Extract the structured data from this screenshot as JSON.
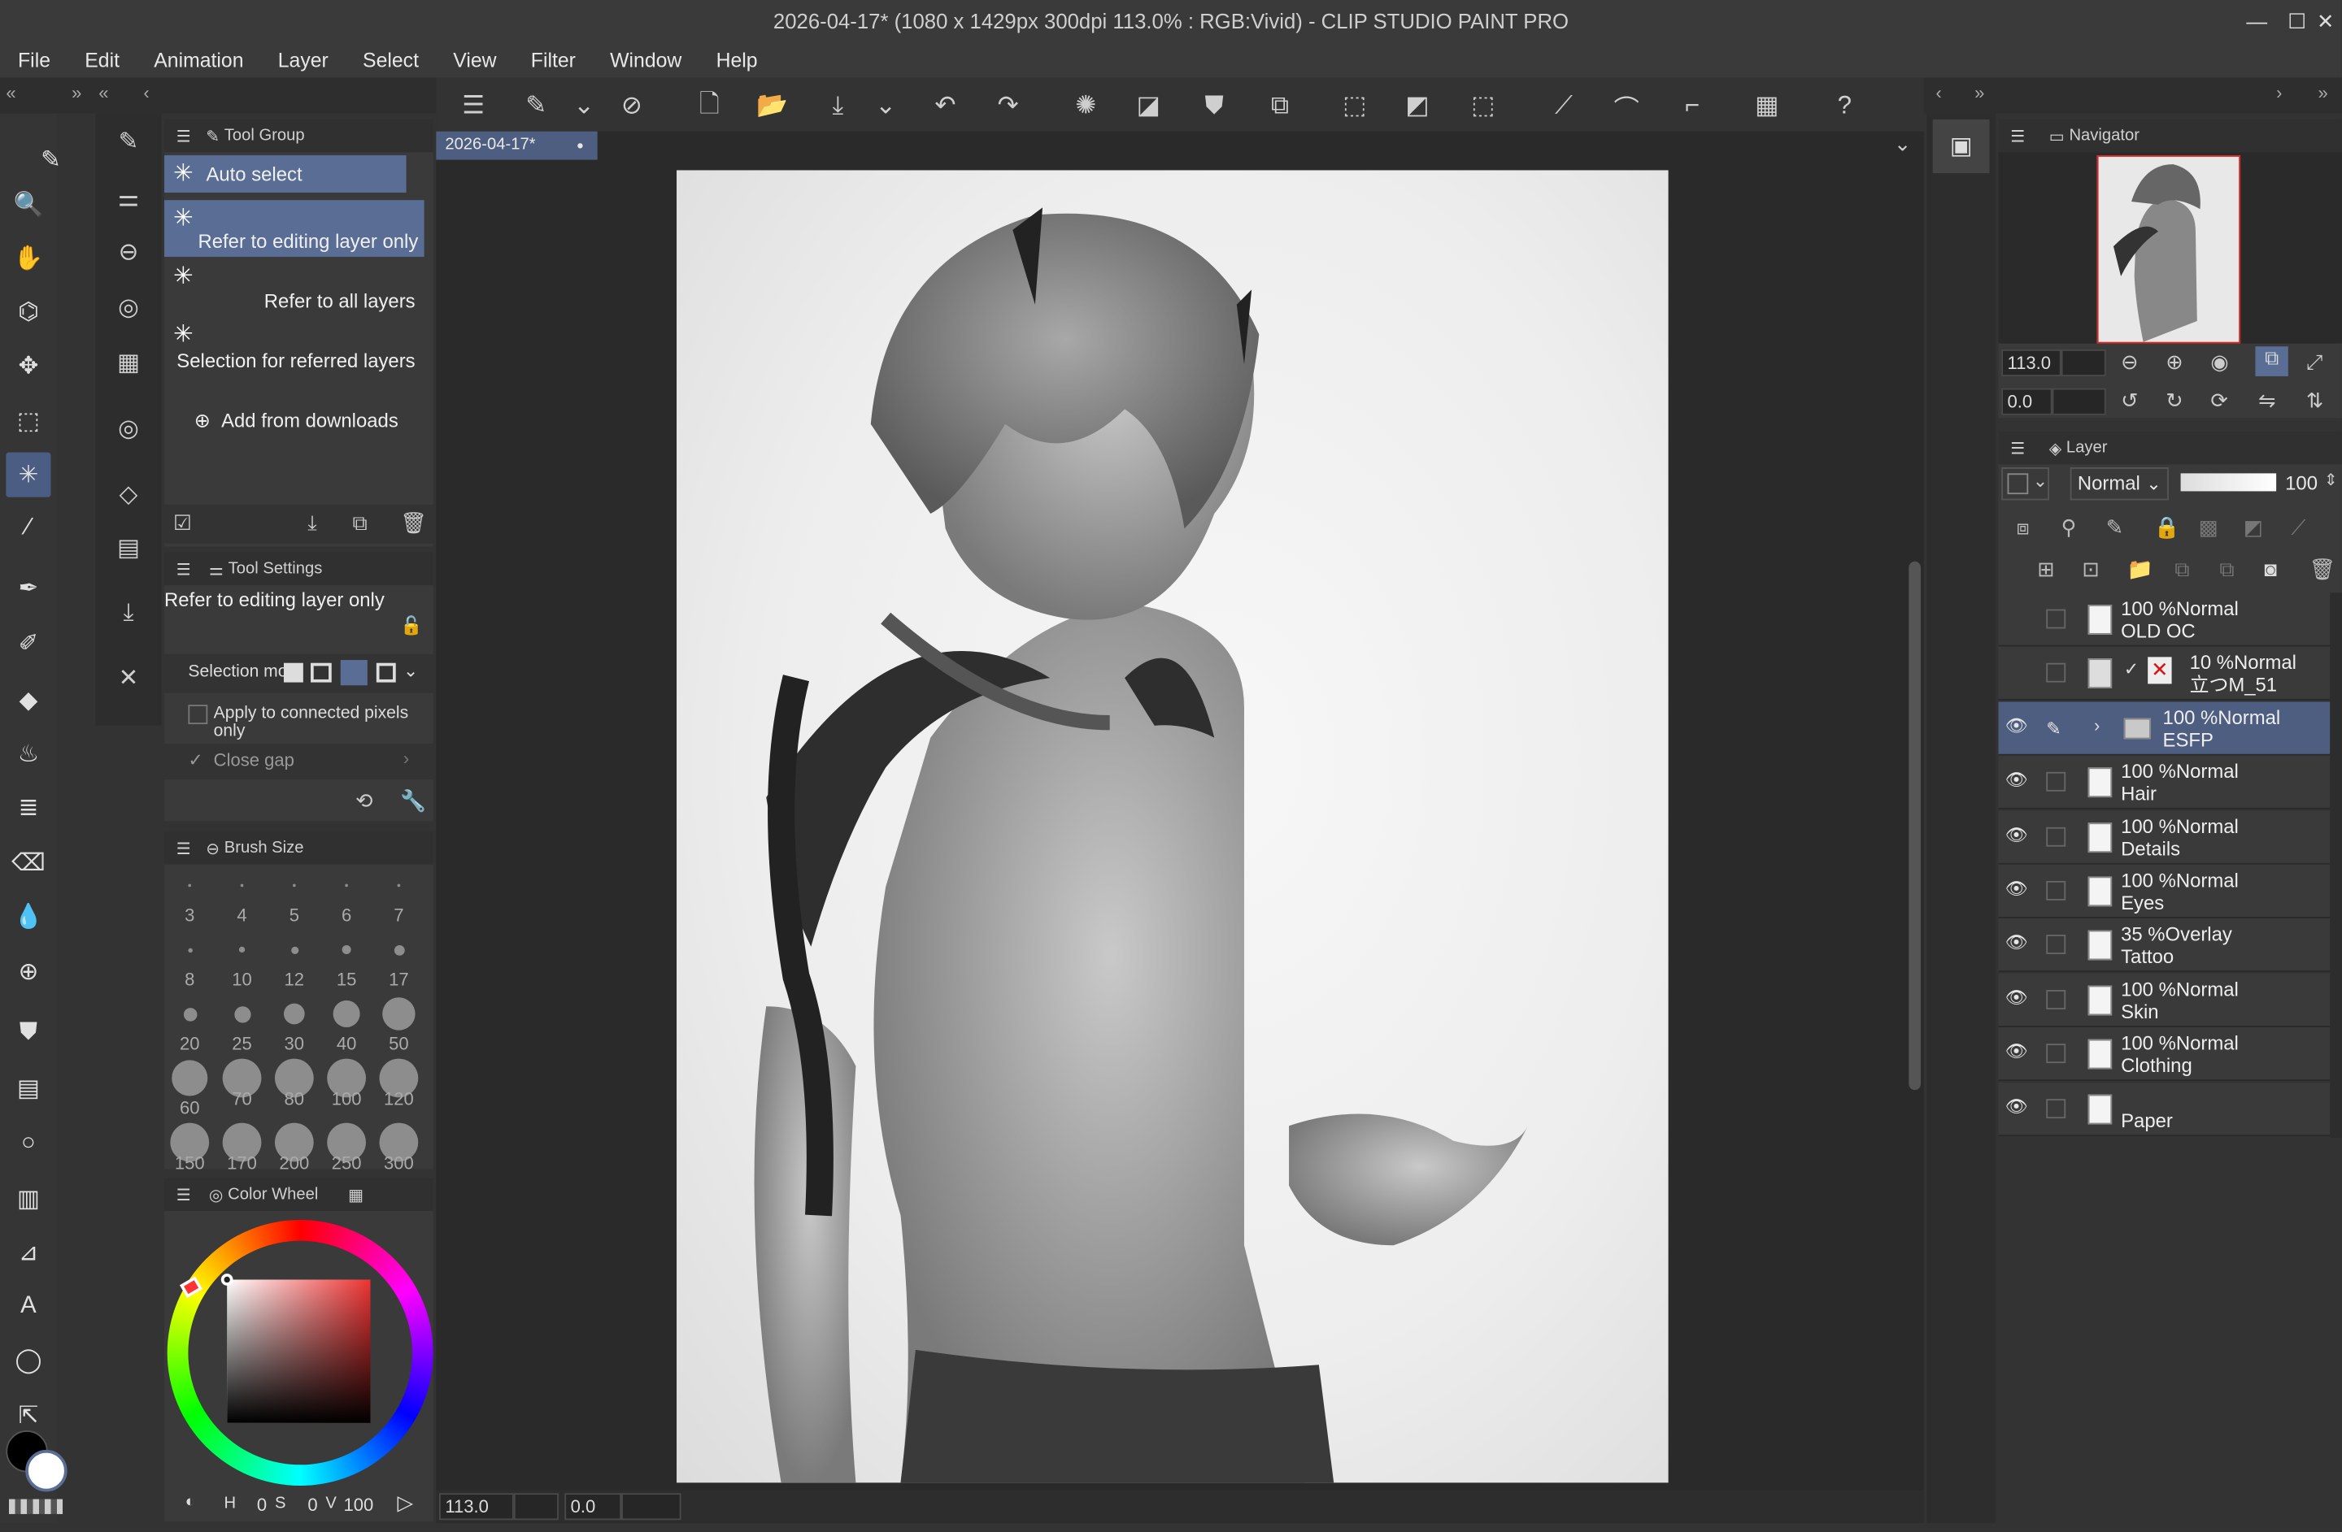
{
  "window": {
    "title": "2026-04-17* (1080 x 1429px 300dpi 113.0% : RGB:Vivid)  - CLIP STUDIO PAINT PRO",
    "min": "—",
    "max": "☐",
    "close": "✕"
  },
  "menu": [
    "File",
    "Edit",
    "Animation",
    "Layer",
    "Select",
    "View",
    "Filter",
    "Window",
    "Help"
  ],
  "tool_group": {
    "title": "Tool Group",
    "items": [
      "Auto select",
      "Refer to editing layer only",
      "Refer to all layers",
      "Selection for referred layers"
    ],
    "add": "Add from downloads"
  },
  "tool_settings": {
    "title": "Tool Settings",
    "subtool": "Refer to editing layer only",
    "selection_mode": "Selection mo",
    "apply_connected": "Apply to connected pixels only",
    "close_gap": "Close gap"
  },
  "brush_size": {
    "title": "Brush Size",
    "sizes": [
      "3",
      "4",
      "5",
      "6",
      "7",
      "8",
      "10",
      "12",
      "15",
      "17",
      "20",
      "25",
      "30",
      "40",
      "50",
      "60",
      "70",
      "80",
      "100",
      "120",
      "150",
      "170",
      "200",
      "250",
      "300"
    ]
  },
  "color_wheel": {
    "title": "Color Wheel",
    "h": "0",
    "s": "0",
    "v": "100",
    "h_label": "H",
    "s_label": "S",
    "v_label": "V"
  },
  "canvas": {
    "tab": "2026-04-17*",
    "zoom": "113.0",
    "rotation": "0.0"
  },
  "navigator": {
    "title": "Navigator",
    "zoom": "113.0",
    "rotation": "0.0"
  },
  "layer_panel": {
    "title": "Layer",
    "blend": "Normal",
    "opacity": "100"
  },
  "layers": [
    {
      "opacity": "100 %",
      "mode": "Normal",
      "name": "OLD OC",
      "visible": false
    },
    {
      "opacity": "10 %",
      "mode": "Normal",
      "name": "立つM_51",
      "visible": false
    },
    {
      "opacity": "100 %",
      "mode": "Normal",
      "name": "ESFP",
      "visible": true,
      "selected": true,
      "folder": true
    },
    {
      "opacity": "100 %",
      "mode": "Normal",
      "name": "Hair",
      "visible": true
    },
    {
      "opacity": "100 %",
      "mode": "Normal",
      "name": "Details",
      "visible": true
    },
    {
      "opacity": "100 %",
      "mode": "Normal",
      "name": "Eyes",
      "visible": true
    },
    {
      "opacity": "35 %",
      "mode": "Overlay",
      "name": "Tattoo",
      "visible": true
    },
    {
      "opacity": "100 %",
      "mode": "Normal",
      "name": "Skin",
      "visible": true
    },
    {
      "opacity": "100 %",
      "mode": "Normal",
      "name": "Clothing",
      "visible": true
    },
    {
      "opacity": "",
      "mode": "",
      "name": "Paper",
      "visible": true
    }
  ],
  "colors": {
    "accent": "#5a6d94",
    "panel": "#3a3a3a",
    "bg": "#2b2b2b"
  }
}
